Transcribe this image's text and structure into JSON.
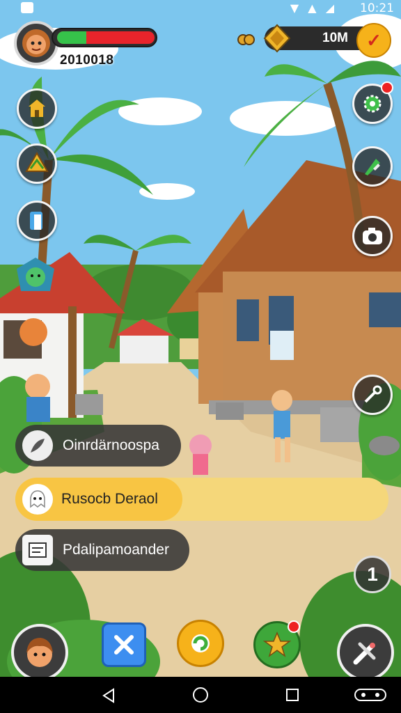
{
  "status_bar": {
    "time": "10:21"
  },
  "hud": {
    "player_id": "2010018",
    "health_fraction": 0.3,
    "currency_value": "10M"
  },
  "menu": {
    "items": [
      {
        "label": "Oinrdärnoospa"
      },
      {
        "label": "Rusocb Deraol"
      },
      {
        "label": "Pdalipamoander"
      }
    ]
  },
  "side_button": {
    "number": "1"
  },
  "colors": {
    "accent_yellow": "#f8c543",
    "health_red": "#e8242b",
    "health_green": "#36c24a",
    "panel_dark": "#2b2b2b"
  },
  "icons": {
    "top_left": "villager-avatar-icon",
    "left_column": [
      "house-lantern-icon",
      "leaf-map-icon",
      "door-icon",
      "shield-villager-icon"
    ],
    "right_column": [
      "settings-gear-icon",
      "build-hammer-icon",
      "camera-icon",
      "tools-icon"
    ],
    "bottom_bar": [
      "character-icon",
      "close-icon",
      "refresh-icon",
      "star-quest-icon",
      "edit-tools-icon"
    ]
  }
}
